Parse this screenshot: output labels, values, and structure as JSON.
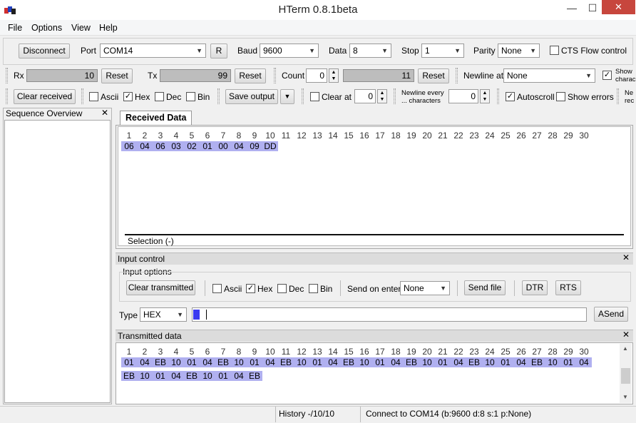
{
  "window": {
    "title": "HTerm 0.8.1beta",
    "minimize": "—",
    "maximize": "☐",
    "close": "✕"
  },
  "menu": [
    "File",
    "Options",
    "View",
    "Help"
  ],
  "connection": {
    "disconnect_label": "Disconnect",
    "port_label": "Port",
    "port_value": "COM14",
    "r_label": "R",
    "baud_label": "Baud",
    "baud_value": "9600",
    "data_label": "Data",
    "data_value": "8",
    "stop_label": "Stop",
    "stop_value": "1",
    "parity_label": "Parity",
    "parity_value": "None",
    "cts_label": "CTS Flow control"
  },
  "counters": {
    "rx_label": "Rx",
    "rx_value": "10",
    "rx_reset": "Reset",
    "tx_label": "Tx",
    "tx_value": "99",
    "tx_reset": "Reset",
    "count_label": "Count",
    "count_value": "0",
    "count_result": "11",
    "count_reset": "Reset",
    "newline_at_label": "Newline at",
    "newline_at_value": "None",
    "show_chars_label_1": "Show",
    "show_chars_label_2": "charac"
  },
  "display_opts": {
    "clear_received": "Clear received",
    "ascii": "Ascii",
    "hex": "Hex",
    "dec": "Dec",
    "bin": "Bin",
    "save_output": "Save output",
    "clear_at": "Clear at",
    "clear_at_value": "0",
    "newline_every_1": "Newline every",
    "newline_every_2": "... characters",
    "newline_every_value": "0",
    "autoscroll": "Autoscroll",
    "show_errors": "Show errors",
    "ne_1": "Ne",
    "ne_2": "rec"
  },
  "sequence": {
    "title": "Sequence Overview",
    "close": "✕"
  },
  "received": {
    "tab_label": "Received Data",
    "header": [
      "1",
      "2",
      "3",
      "4",
      "5",
      "6",
      "7",
      "8",
      "9",
      "10",
      "11",
      "12",
      "13",
      "14",
      "15",
      "16",
      "17",
      "18",
      "19",
      "20",
      "21",
      "22",
      "23",
      "24",
      "25",
      "26",
      "27",
      "28",
      "29",
      "30"
    ],
    "bytes": [
      "06",
      "04",
      "06",
      "03",
      "02",
      "01",
      "00",
      "04",
      "09",
      "DD"
    ],
    "selection": "Selection (-)"
  },
  "input_control": {
    "title": "Input control",
    "close": "✕",
    "options_label": "Input options",
    "clear_transmitted": "Clear transmitted",
    "ascii": "Ascii",
    "hex": "Hex",
    "dec": "Dec",
    "bin": "Bin",
    "send_on_enter_label": "Send on enter",
    "send_on_enter_value": "None",
    "send_file": "Send file",
    "dtr": "DTR",
    "rts": "RTS",
    "type_label": "Type",
    "type_value": "HEX",
    "asend": "ASend"
  },
  "transmitted": {
    "title": "Transmitted data",
    "close": "✕",
    "header": [
      "1",
      "2",
      "3",
      "4",
      "5",
      "6",
      "7",
      "8",
      "9",
      "10",
      "11",
      "12",
      "13",
      "14",
      "15",
      "16",
      "17",
      "18",
      "19",
      "20",
      "21",
      "22",
      "23",
      "24",
      "25",
      "26",
      "27",
      "28",
      "29",
      "30"
    ],
    "row1": [
      "01",
      "04",
      "EB",
      "10",
      "01",
      "04",
      "EB",
      "10",
      "01",
      "04",
      "EB",
      "10",
      "01",
      "04",
      "EB",
      "10",
      "01",
      "04",
      "EB",
      "10",
      "01",
      "04",
      "EB",
      "10",
      "01",
      "04",
      "EB",
      "10",
      "01",
      "04"
    ],
    "row2": [
      "EB",
      "10",
      "01",
      "04",
      "EB",
      "10",
      "01",
      "04",
      "EB"
    ]
  },
  "status": {
    "history": "History -/10/10",
    "connection": "Connect to COM14 (b:9600 d:8 s:1 p:None)"
  }
}
